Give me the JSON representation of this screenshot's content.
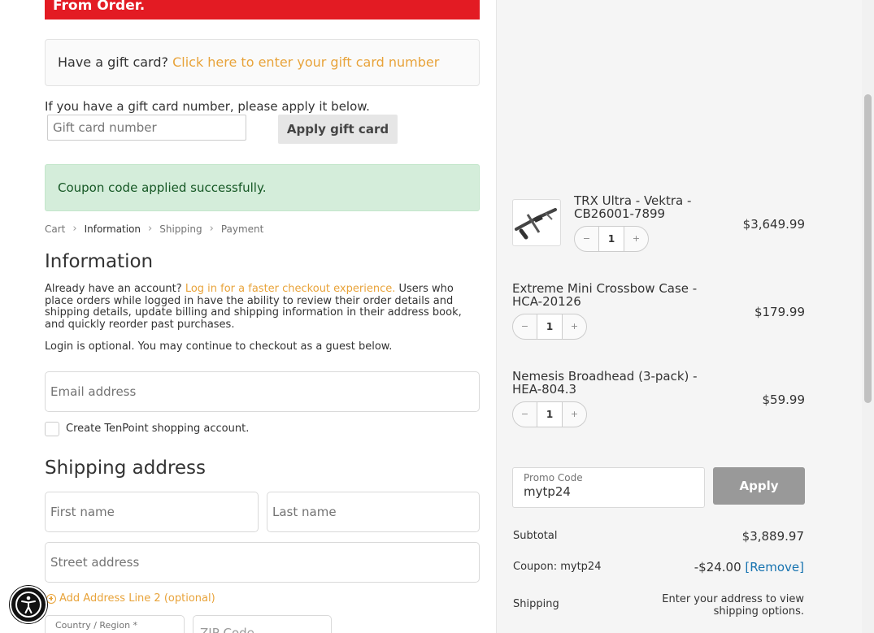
{
  "banner": {
    "text": "From Order."
  },
  "gift": {
    "prompt": "Have a gift card?",
    "link": "Click here to enter your gift card number",
    "help": "If you have a gift card number, please apply it below.",
    "input_placeholder": "Gift card number",
    "apply_label": "Apply gift card"
  },
  "notice": {
    "success": "Coupon code applied successfully."
  },
  "breadcrumb": {
    "items": [
      "Cart",
      "Information",
      "Shipping",
      "Payment"
    ],
    "active": "Information"
  },
  "information": {
    "title": "Information",
    "account_prefix": "Already have an account?",
    "login_link": "Log in for a faster checkout experience.",
    "account_suffix": "Users who place orders while logged in have the ability to review their order details and shipping details, update billing and shipping information in their address book, and quickly reorder past purchases.",
    "optional_note": "Login is optional. You may continue to checkout as a guest below.",
    "email_placeholder": "Email address",
    "create_account_label": "Create TenPoint shopping account."
  },
  "shipping": {
    "title": "Shipping address",
    "first_name_placeholder": "First name",
    "last_name_placeholder": "Last name",
    "street_placeholder": "Street address",
    "add_line2": "Add Address Line 2 (optional)",
    "country_label": "Country / Region *",
    "zip_placeholder": "ZIP Code"
  },
  "cart": {
    "items": [
      {
        "name": "TRX Ultra - Vektra - CB26001-7899",
        "qty": "1",
        "price": "$3,649.99"
      },
      {
        "name": "Extreme Mini Crossbow Case - HCA-20126",
        "qty": "1",
        "price": "$179.99"
      },
      {
        "name": "Nemesis Broadhead (3-pack) - HEA-804.3",
        "qty": "1",
        "price": "$59.99"
      }
    ],
    "minus": "−",
    "plus": "+"
  },
  "promo": {
    "label": "Promo Code",
    "value": "mytp24",
    "apply_label": "Apply"
  },
  "totals": {
    "subtotal_label": "Subtotal",
    "subtotal_value": "$3,889.97",
    "coupon_label": "Coupon: mytp24",
    "coupon_value": "-$24.00",
    "remove_label": "[Remove]",
    "shipping_label": "Shipping",
    "shipping_value": "Enter your address to view shipping options."
  },
  "colors": {
    "banner": "#e31b23",
    "link": "#e8a33a",
    "success_bg": "#d4edda",
    "remove": "#1773b0"
  },
  "icons": {
    "accessibility": "accessibility-icon",
    "chevron": "chevron-right-icon",
    "add": "plus-circle-icon",
    "product": "crossbow-image"
  }
}
